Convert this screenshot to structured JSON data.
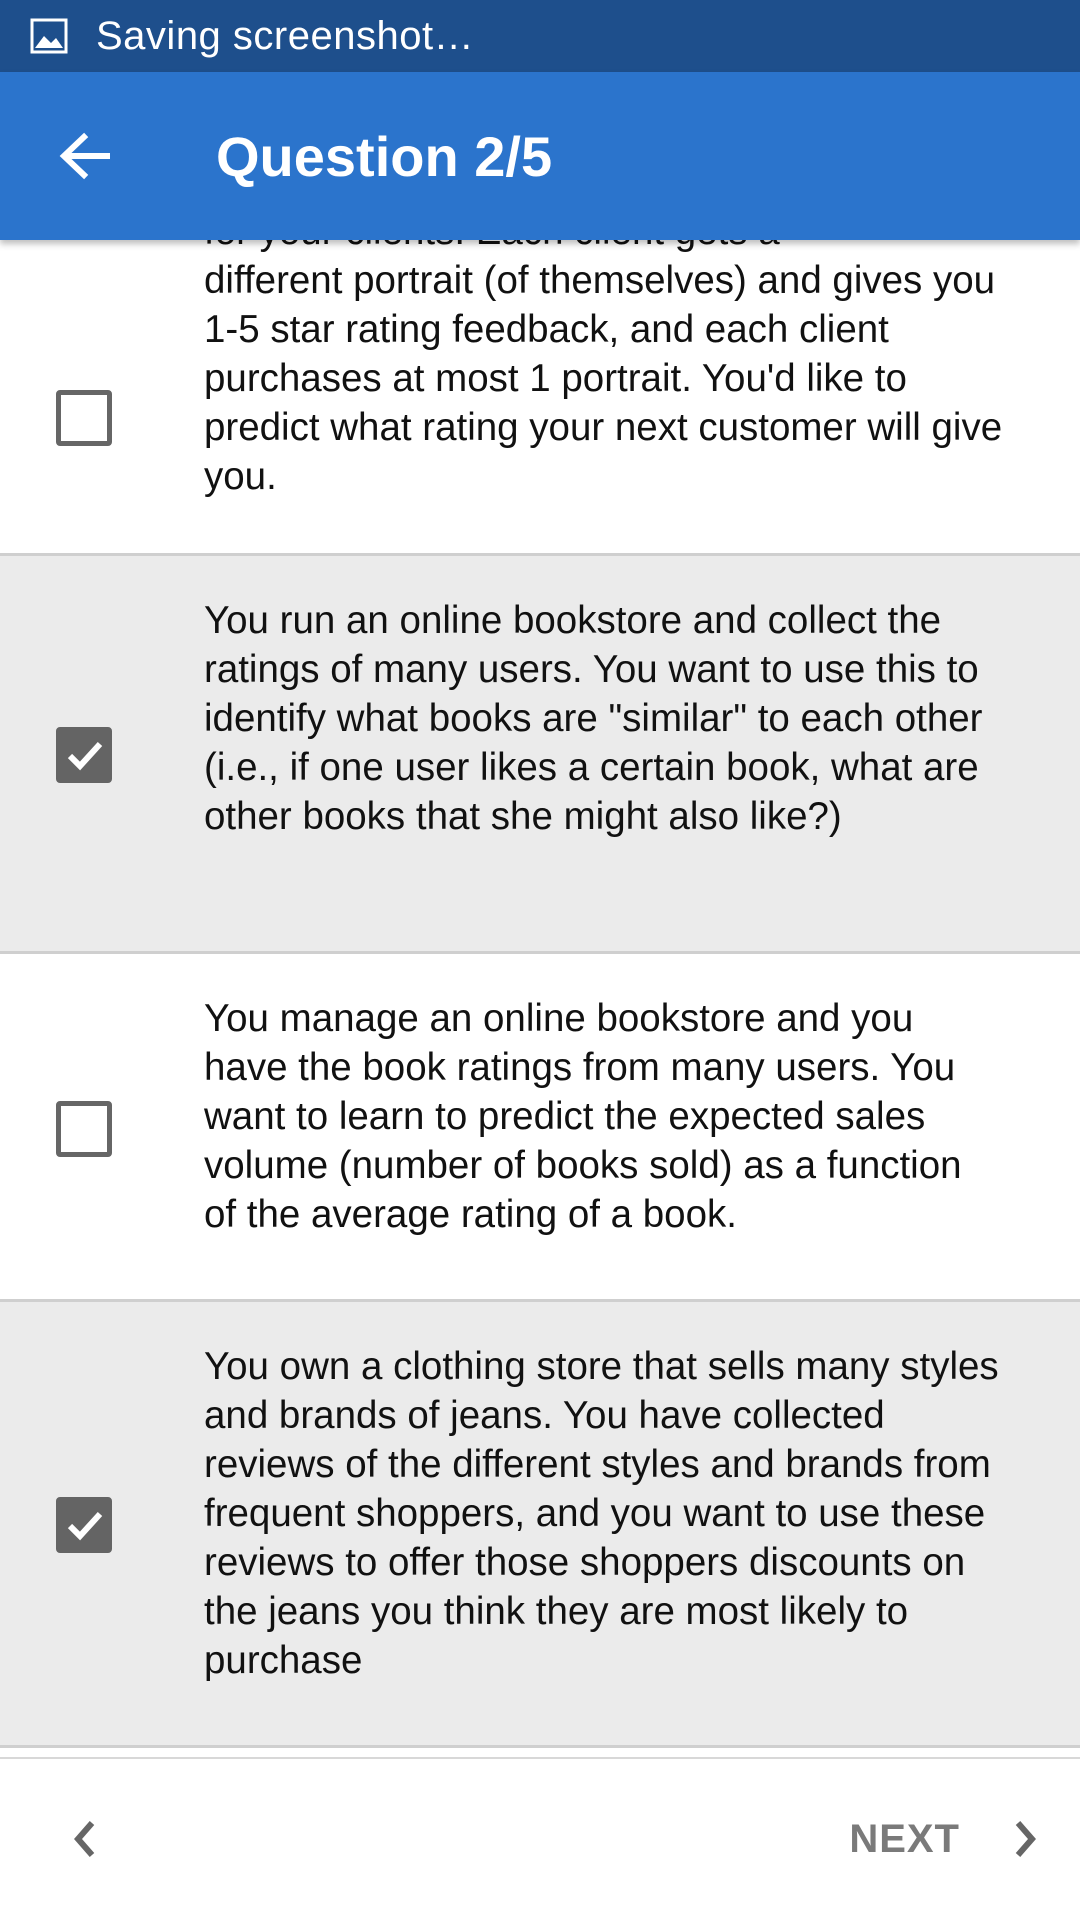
{
  "status_bar": {
    "icon": "image-icon",
    "text": "Saving screenshot…"
  },
  "app_bar": {
    "back_icon": "arrow-back-icon",
    "title": "Question 2/5"
  },
  "options": [
    {
      "checked": false,
      "partial_top_line": "for your clients. Each client gets a",
      "text": "different portrait (of themselves) and gives you 1-5 star rating feedback, and each client purchases at most 1 portrait. You'd like to predict what rating your next customer will give you."
    },
    {
      "checked": true,
      "text": "You run an online bookstore and collect the ratings of many users. You want to use this to identify what books are \"similar\" to each other (i.e., if one user likes a certain book, what are other books that she might also like?)"
    },
    {
      "checked": false,
      "text": "You manage an online bookstore and you have the book ratings from many users. You want to learn to predict the expected sales volume (number of books sold) as a function of the average rating of a book."
    },
    {
      "checked": true,
      "text": "You own a clothing store that sells many styles and brands of jeans. You have collected reviews of the different styles and brands from frequent shoppers, and you want to use these reviews to offer those shoppers discounts on the jeans you think they are most likely to purchase"
    }
  ],
  "footer": {
    "prev_icon": "chevron-left-icon",
    "next_label": "NEXT",
    "next_icon": "chevron-right-icon"
  },
  "colors": {
    "status_bar": "#1e4f8c",
    "app_bar": "#2b74cc",
    "checked_row": "#ebebeb",
    "checkbox_checked": "#646464",
    "next_label": "#7a7a7a"
  }
}
